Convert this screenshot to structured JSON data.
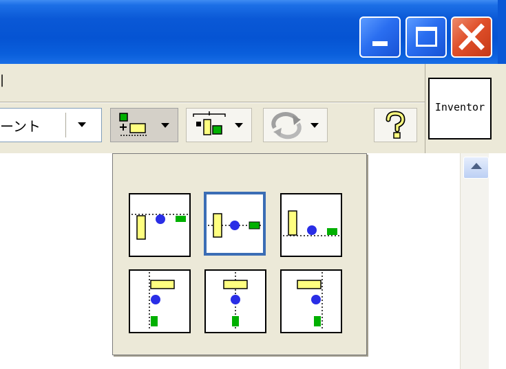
{
  "toolbar": {
    "style_combo_text": "ーント",
    "help_icon_glyph": "?"
  },
  "menu": {
    "partial_item": "|"
  },
  "inventor": {
    "label": "Inventor"
  },
  "popup": {
    "options": [
      {
        "name": "align-top",
        "selected": false
      },
      {
        "name": "align-center",
        "selected": true
      },
      {
        "name": "align-bottom",
        "selected": false
      },
      {
        "name": "align-left",
        "selected": false
      },
      {
        "name": "align-middle",
        "selected": false
      },
      {
        "name": "align-right",
        "selected": false
      }
    ]
  },
  "colors": {
    "yellow_shape": "#ffff80",
    "green_shape": "#00b000",
    "blue_circle": "#2a2ee6",
    "selected_border": "#3b6db5",
    "titlebar": "#0554d3"
  }
}
